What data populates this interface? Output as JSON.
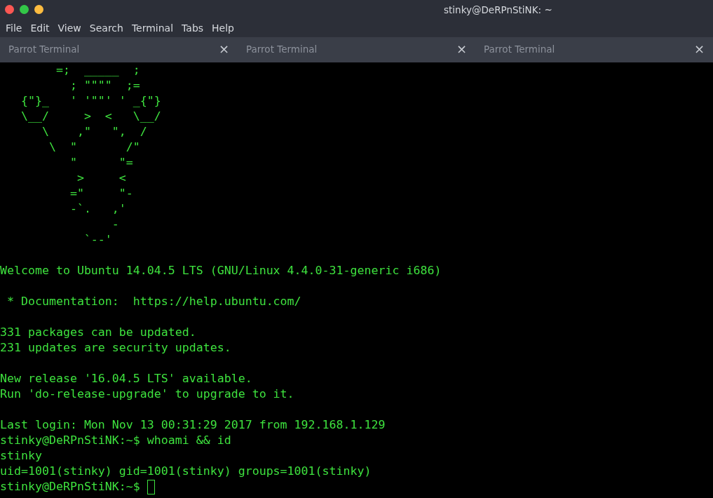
{
  "window": {
    "title": "stinky@DeRPnStiNK: ~"
  },
  "menu": [
    "File",
    "Edit",
    "View",
    "Search",
    "Terminal",
    "Tabs",
    "Help"
  ],
  "tabs": [
    {
      "label": "Parrot Terminal",
      "close": "×",
      "selected": false
    },
    {
      "label": "Parrot Terminal",
      "close": "×",
      "selected": false
    },
    {
      "label": "Parrot Terminal",
      "close": "×",
      "selected": false
    }
  ],
  "terminal": {
    "cursor": true,
    "blocks": [
      {
        "lines": [
          "        =;  _____  ;",
          "          ; \"\"\"\"  ;=",
          "   {\"}_   ' '\"\"' ' _{\"}",
          "   \\__/     >  <   \\__/",
          "      \\    ,\"   \",  /",
          "       \\  \"       /\"",
          "          \"      \"=",
          "           >     <",
          "          =\"     \"-",
          "          -`.   ,'",
          "                -",
          "            `--'"
        ]
      },
      {
        "lines": [
          "Welcome to Ubuntu 14.04.5 LTS (GNU/Linux 4.4.0-31-generic i686)"
        ]
      },
      {
        "lines": [
          " * Documentation:  https://help.ubuntu.com/"
        ]
      },
      {
        "lines": [
          "331 packages can be updated.",
          "231 updates are security updates."
        ]
      },
      {
        "lines": [
          "New release '16.04.5 LTS' available.",
          "Run 'do-release-upgrade' to upgrade to it."
        ]
      },
      {
        "lines": [
          "Last login: Mon Nov 13 00:31:29 2017 from 192.168.1.129",
          "stinky@DeRPnStiNK:~$ whoami && id",
          "stinky",
          "uid=1001(stinky) gid=1001(stinky) groups=1001(stinky)",
          "stinky@DeRPnStiNK:~$ "
        ]
      }
    ]
  }
}
